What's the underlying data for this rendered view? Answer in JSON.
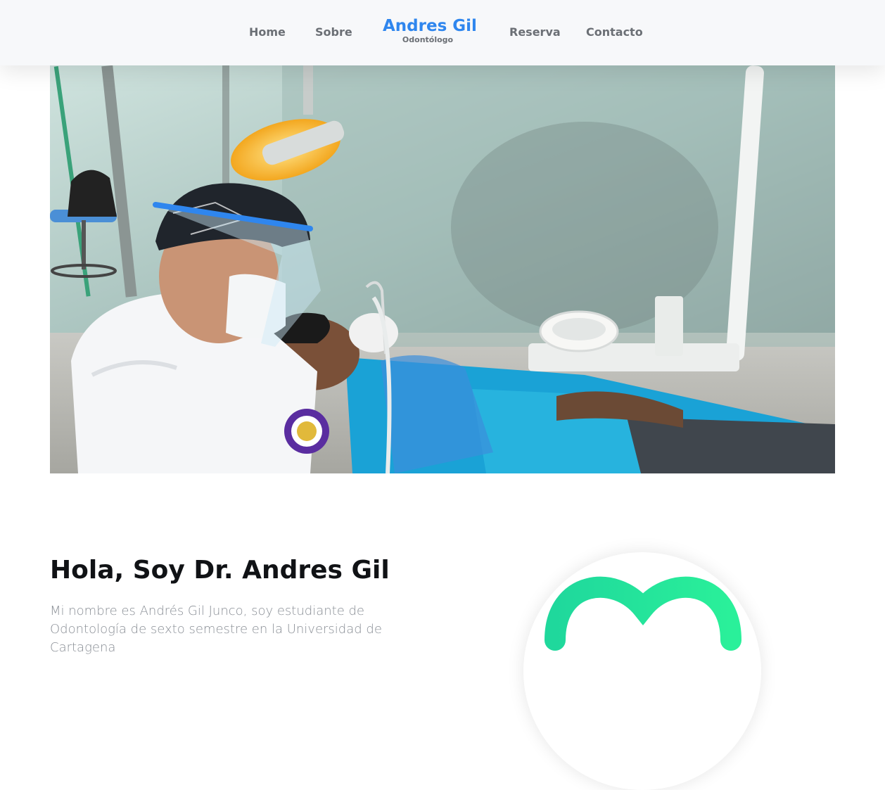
{
  "nav": {
    "links": [
      "Home",
      "Sobre",
      "Reserva",
      "Contacto"
    ],
    "brand_name": "Andres Gil",
    "brand_sub": "Odontólogo"
  },
  "hero": {
    "image": "dentist-treating-patient-photo"
  },
  "intro": {
    "title": "Hola, Soy Dr. Andres Gil",
    "text": "Mi nombre es Andrés Gil Junco, soy estudiante de Odontología de sexto semestre en la Universidad de Cartagena"
  },
  "colors": {
    "brand": "#2f86ee",
    "logo_green": "#22e59a",
    "nav_bg": "#f7f8fa"
  }
}
